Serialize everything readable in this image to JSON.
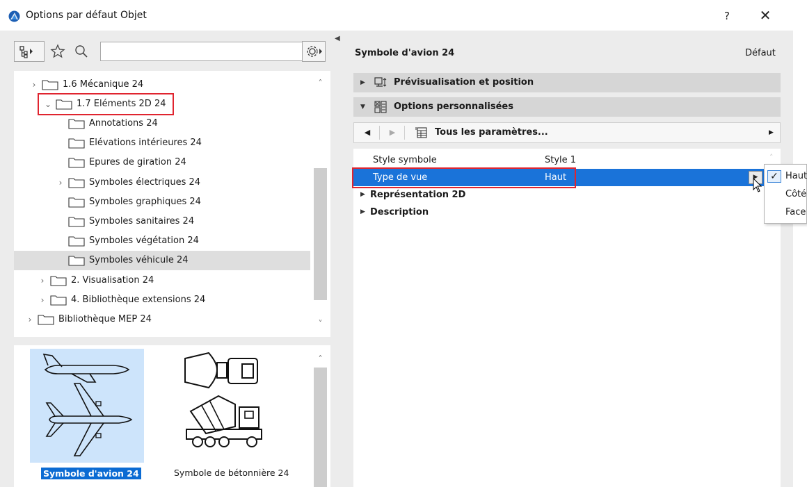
{
  "window": {
    "title": "Options par défaut Objet",
    "help_label": "?",
    "close_label": "✕"
  },
  "toolbar": {
    "search_value": "",
    "search_placeholder": ""
  },
  "tree": {
    "items": [
      {
        "label": "1.6 Mécanique 24",
        "expanded": false,
        "has_children": true
      },
      {
        "label": "1.7 Eléments 2D 24",
        "expanded": true,
        "has_children": true
      },
      {
        "label": "Annotations 24"
      },
      {
        "label": "Elévations intérieures 24"
      },
      {
        "label": "Epures de giration 24"
      },
      {
        "label": "Symboles électriques 24",
        "has_children": true
      },
      {
        "label": "Symboles graphiques 24"
      },
      {
        "label": "Symboles sanitaires 24"
      },
      {
        "label": "Symboles végétation 24"
      },
      {
        "label": "Symboles véhicule 24",
        "selected": true
      },
      {
        "label": "2. Visualisation 24",
        "has_children": true
      },
      {
        "label": "4. Bibliothèque extensions 24",
        "has_children": true
      },
      {
        "label": "Bibliothèque MEP 24",
        "has_children": true
      }
    ]
  },
  "previews": [
    {
      "label": "Symbole d'avion 24",
      "selected": true,
      "icon": "airplane-icon"
    },
    {
      "label": "Symbole de bétonnière 24",
      "selected": false,
      "icon": "concrete-mixer-icon"
    }
  ],
  "right": {
    "object_title": "Symbole d'avion 24",
    "default_label": "Défaut",
    "sections": [
      {
        "label": "Prévisualisation et position",
        "expanded": false
      },
      {
        "label": "Options personnalisées",
        "expanded": true
      }
    ],
    "nav_label": "Tous les paramètres...",
    "params": [
      {
        "name": "Style symbole",
        "value": "Style 1"
      },
      {
        "name": "Type de vue",
        "value": "Haut",
        "active": true
      }
    ],
    "groups": [
      {
        "label": "Représentation 2D"
      },
      {
        "label": "Description"
      }
    ]
  },
  "menu": {
    "items": [
      {
        "label": "Haut",
        "checked": true
      },
      {
        "label": "Côté",
        "checked": false
      },
      {
        "label": "Face",
        "checked": false
      }
    ]
  },
  "colors": {
    "selection_blue": "#1a73d9",
    "highlight_red": "#e0242f",
    "thumb_selected_bg": "#cde4fb"
  }
}
